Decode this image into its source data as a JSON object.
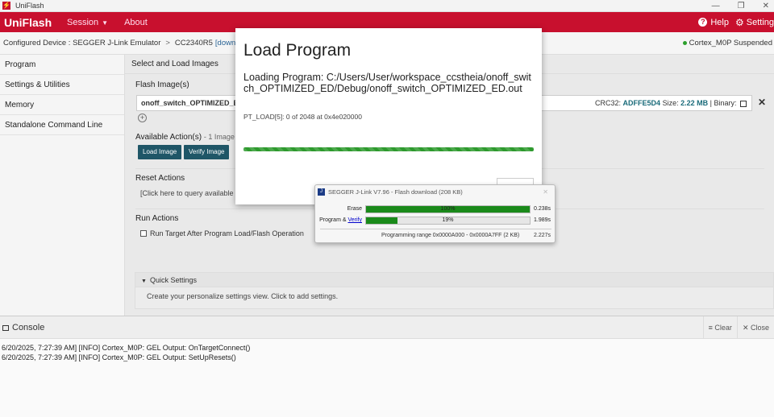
{
  "window": {
    "title": "UniFlash",
    "app_icon": "uniflash-logo-icon"
  },
  "header": {
    "brand": "UniFlash",
    "menu": [
      {
        "label": "Session"
      },
      {
        "label": "About"
      }
    ],
    "help_label": "Help",
    "settings_label": "Setting",
    "brand_color": "#c8102e"
  },
  "device_bar": {
    "configured_label": "Configured Device : SEGGER J-Link Emulator",
    "separator": ">",
    "device": "CC2340R5",
    "download_link": "[download ccxml]",
    "status": "Cortex_M0P Suspended"
  },
  "sidebar": {
    "items": [
      {
        "label": "Program"
      },
      {
        "label": "Settings & Utilities"
      },
      {
        "label": "Memory"
      },
      {
        "label": "Standalone Command Line"
      }
    ]
  },
  "main": {
    "section_title": "Select and Load Images",
    "flash_label": "Flash Image(s)",
    "file_name": "onoff_switch_OPTIMIZED_ED.o",
    "crc_label": "CRC32:",
    "crc_value": "ADFFE5D4",
    "size_label": "Size:",
    "size_value": "2.22 MB",
    "binary_label": "| Binary:",
    "actions_label": "Available Action(s)",
    "actions_suffix": "- 1 Image Se",
    "load_button": "Load Image",
    "verify_button": "Verify Image",
    "reset_label": "Reset Actions",
    "reset_query": "[Click here to query available re",
    "run_label": "Run Actions",
    "run_checkbox": "Run Target After Program Load/Flash Operation",
    "quick_settings": "Quick Settings",
    "quick_settings_body": "Create your personalize settings view. Click to add settings."
  },
  "console": {
    "title": "Console",
    "clear_label": "Clear",
    "close_label": "Close",
    "lines": [
      "6/20/2025, 7:27:39 AM] [INFO] Cortex_M0P: GEL Output: OnTargetConnect()",
      "6/20/2025, 7:27:39 AM] [INFO] Cortex_M0P: GEL Output: SetUpResets()"
    ]
  },
  "load_dialog": {
    "title": "Load Program",
    "message": "Loading Program: C:/Users/User/workspace_ccstheia/onoff_switch_OPTIMIZED_ED/Debug/onoff_switch_OPTIMIZED_ED.out",
    "status": "PT_LOAD[5]: 0 of 2048 at 0x4e020000",
    "progress_color": "#2e9a2e"
  },
  "segger": {
    "title": "SEGGER J-Link V7.96 - Flash download (208 KB)",
    "erase_label": "Erase",
    "erase_percent": "100%",
    "erase_fraction": 1.0,
    "erase_time": "0.238s",
    "program_label": "Program &",
    "verify_link": "Verify",
    "program_percent": "19%",
    "program_fraction": 0.19,
    "program_time": "1.989s",
    "range_text": "Programming range 0x0000A000 - 0x0000A7FF (2 KB)",
    "total_time": "2.227s",
    "bar_color": "#1a8a1a"
  }
}
